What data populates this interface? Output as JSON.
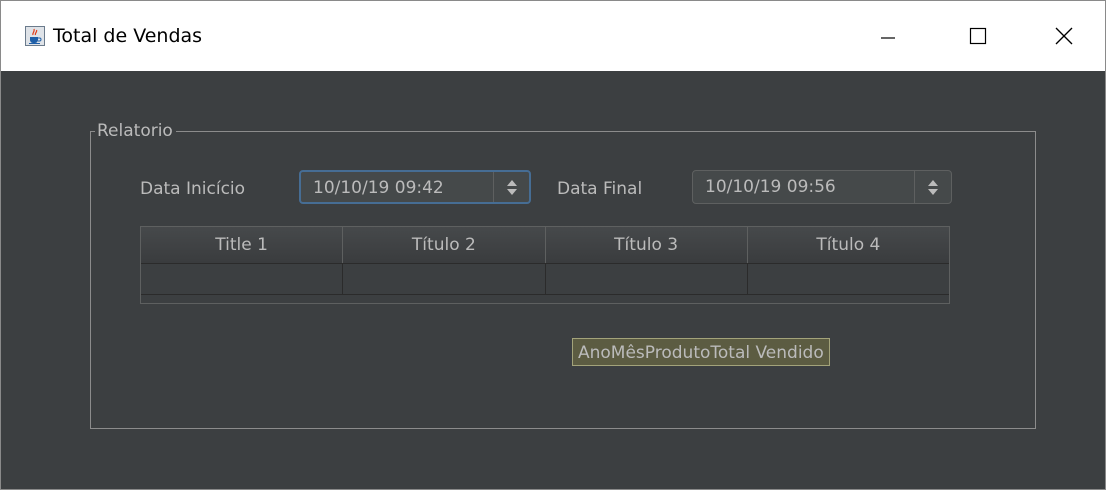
{
  "window": {
    "title": "Total de Vendas",
    "icon": "java-cup-icon"
  },
  "controls": {
    "minimize_icon": "minimize-icon",
    "maximize_icon": "maximize-icon",
    "close_icon": "close-icon"
  },
  "group": {
    "title": "Relatorio"
  },
  "filters": {
    "start_label": "Data Inicício",
    "start_value": "10/10/19 09:42",
    "end_label": "Data Final",
    "end_value": "10/10/19 09:56"
  },
  "table": {
    "columns": [
      "Title 1",
      "Título 2",
      "Título 3",
      "Título 4"
    ],
    "rows": [
      [
        "",
        "",
        "",
        ""
      ]
    ]
  },
  "tooltip": {
    "text": "AnoMêsProdutoTotal Vendido"
  },
  "colors": {
    "background": "#3c3f41",
    "text": "#bbbbbb",
    "focus_border": "#466d94",
    "tooltip_bg": "#5c5c42"
  }
}
